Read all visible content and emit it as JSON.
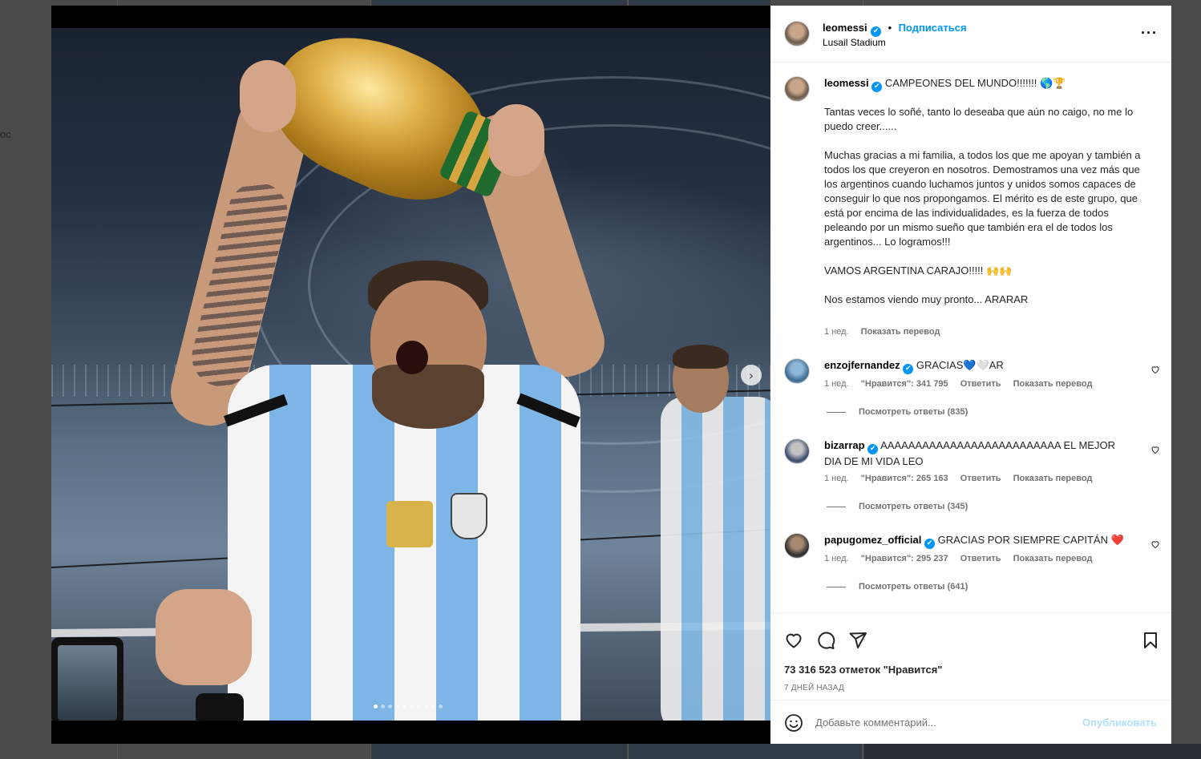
{
  "background": {
    "left_stub_text": "ос"
  },
  "media": {
    "slides_total": 10,
    "active_slide": 1,
    "next_arrow": "›"
  },
  "post": {
    "author": "leomessi",
    "verified_mark": "✔",
    "separator": "•",
    "follow_label": "Подписаться",
    "location": "Lusail Stadium",
    "more_label": "···",
    "caption_title": "CAMPEONES DEL MUNDO!!!!!!! 🌎🏆",
    "caption_body": "Tantas veces lo soñé, tanto lo deseaba que aún no caigo, no me lo puedo creer......\n\nMuchas gracias a mi familia, a todos los que me apoyan y también a todos los que creyeron en nosotros. Demostramos una vez más que los argentinos cuando luchamos juntos y unidos somos capaces de conseguir lo que nos propongamos. El mérito es de este grupo, que está por encima de las individualidades, es la fuerza de todos peleando por un mismo sueño que también era el de todos los argentinos... Lo logramos!!!\n\nVAMOS ARGENTINA CARAJO!!!!! 🙌🙌\n\nNos estamos viendo muy pronto... ARARAR",
    "caption_time": "1 нед.",
    "translate_label": "Показать перевод"
  },
  "comments": [
    {
      "user": "enzojfernandez",
      "text": "GRACIAS💙🤍AR",
      "time": "1 нед.",
      "likes": "\"Нравится\": 341 795",
      "reply_label": "Ответить",
      "translate_label": "Показать перевод",
      "view_replies": "Посмотреть ответы (835)"
    },
    {
      "user": "bizarrap",
      "text": "AAAAAAAAAAAAAAAAAAAAAAAAAA EL MEJOR DIA DE MI VIDA LEO",
      "time": "1 нед.",
      "likes": "\"Нравится\": 265 163",
      "reply_label": "Ответить",
      "translate_label": "Показать перевод",
      "view_replies": "Посмотреть ответы (345)"
    },
    {
      "user": "papugomez_official",
      "text": "GRACIAS POR SIEMPRE CAPITÁN ❤️",
      "time": "1 нед.",
      "likes": "\"Нравится\": 295 237",
      "reply_label": "Ответить",
      "translate_label": "Показать перевод",
      "view_replies": "Посмотреть ответы (641)"
    }
  ],
  "actions": {
    "icons": [
      "heart-icon",
      "comment-icon",
      "share-icon",
      "bookmark-icon"
    ],
    "likes_text": "73 316 523 отметок \"Нравится\"",
    "date_text": "7 ДНЕЙ НАЗАД"
  },
  "add_comment": {
    "emoji_icon": "emoji-icon",
    "placeholder": "Добавьте комментарий...",
    "publish_label": "Опубликовать"
  },
  "colors": {
    "accent": "#0095f6",
    "publish_disabled": "#b2dffc",
    "muted_text": "#737373",
    "heart_red": "#ed4956"
  }
}
